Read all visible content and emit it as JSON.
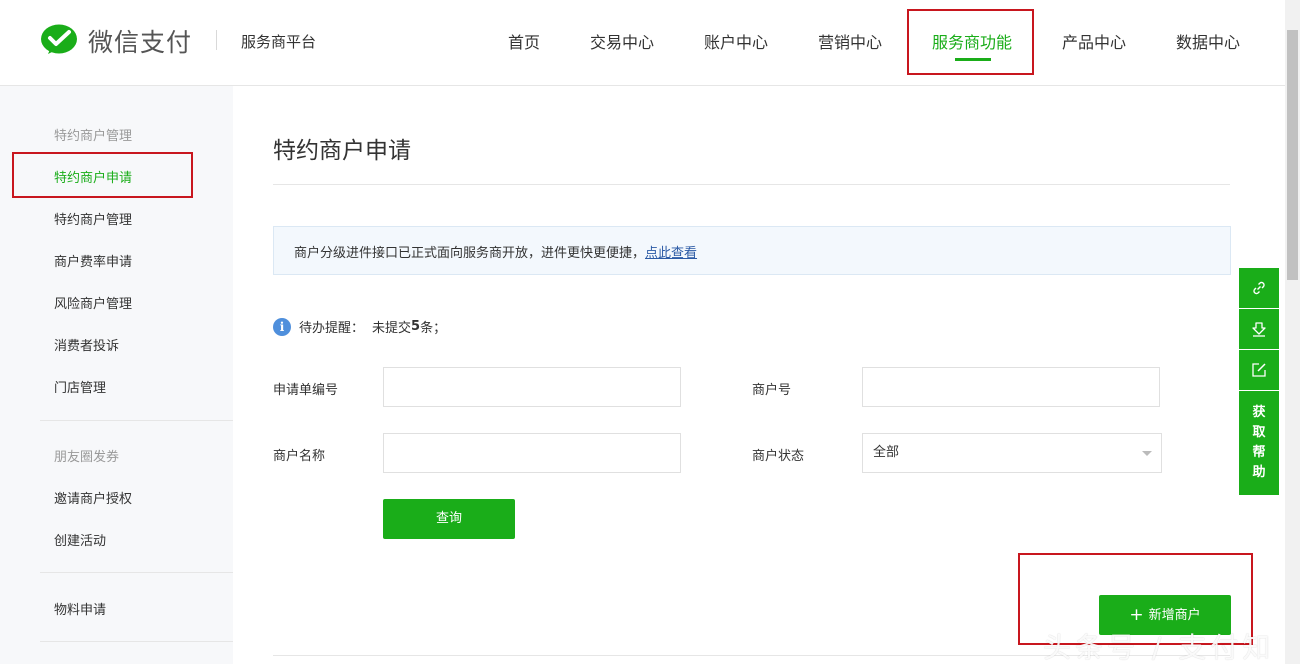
{
  "header": {
    "brand": "微信支付",
    "platform": "服务商平台",
    "nav": [
      {
        "label": "首页"
      },
      {
        "label": "交易中心"
      },
      {
        "label": "账户中心"
      },
      {
        "label": "营销中心"
      },
      {
        "label": "服务商功能",
        "active": true
      },
      {
        "label": "产品中心"
      },
      {
        "label": "数据中心"
      }
    ]
  },
  "sidebar": {
    "groups": [
      {
        "title": "特约商户管理",
        "items": [
          "特约商户申请",
          "特约商户管理",
          "商户费率申请",
          "风险商户管理",
          "消费者投诉",
          "门店管理"
        ]
      },
      {
        "title": "朋友圈发券",
        "items": [
          "邀请商户授权",
          "创建活动"
        ]
      },
      {
        "title": "",
        "items": [
          "物料申请"
        ]
      }
    ],
    "active_item": "特约商户申请"
  },
  "main": {
    "title": "特约商户申请",
    "notice": {
      "text": "商户分级进件接口已正式面向服务商开放，进件更快更便捷，",
      "link": "点此查看"
    },
    "todo": {
      "label": "待办提醒：",
      "text": "未提交",
      "count": "5",
      "suffix": "条；"
    },
    "form": {
      "application_no_label": "申请单编号",
      "application_no_value": "",
      "merchant_no_label": "商户号",
      "merchant_no_value": "",
      "merchant_name_label": "商户名称",
      "merchant_name_value": "",
      "merchant_status_label": "商户状态",
      "merchant_status_value": "全部"
    },
    "query_button": "查询",
    "add_button": "新增商户"
  },
  "float_toolbar": {
    "icons": [
      "link-icon",
      "download-icon",
      "edit-icon"
    ],
    "help_label": [
      "获",
      "取",
      "帮",
      "助"
    ]
  },
  "watermark": "头条号 / 支付知",
  "colors": {
    "brand_green": "#1aad19",
    "annotation_red": "#c8161e",
    "link_blue": "#2b5aa5"
  }
}
